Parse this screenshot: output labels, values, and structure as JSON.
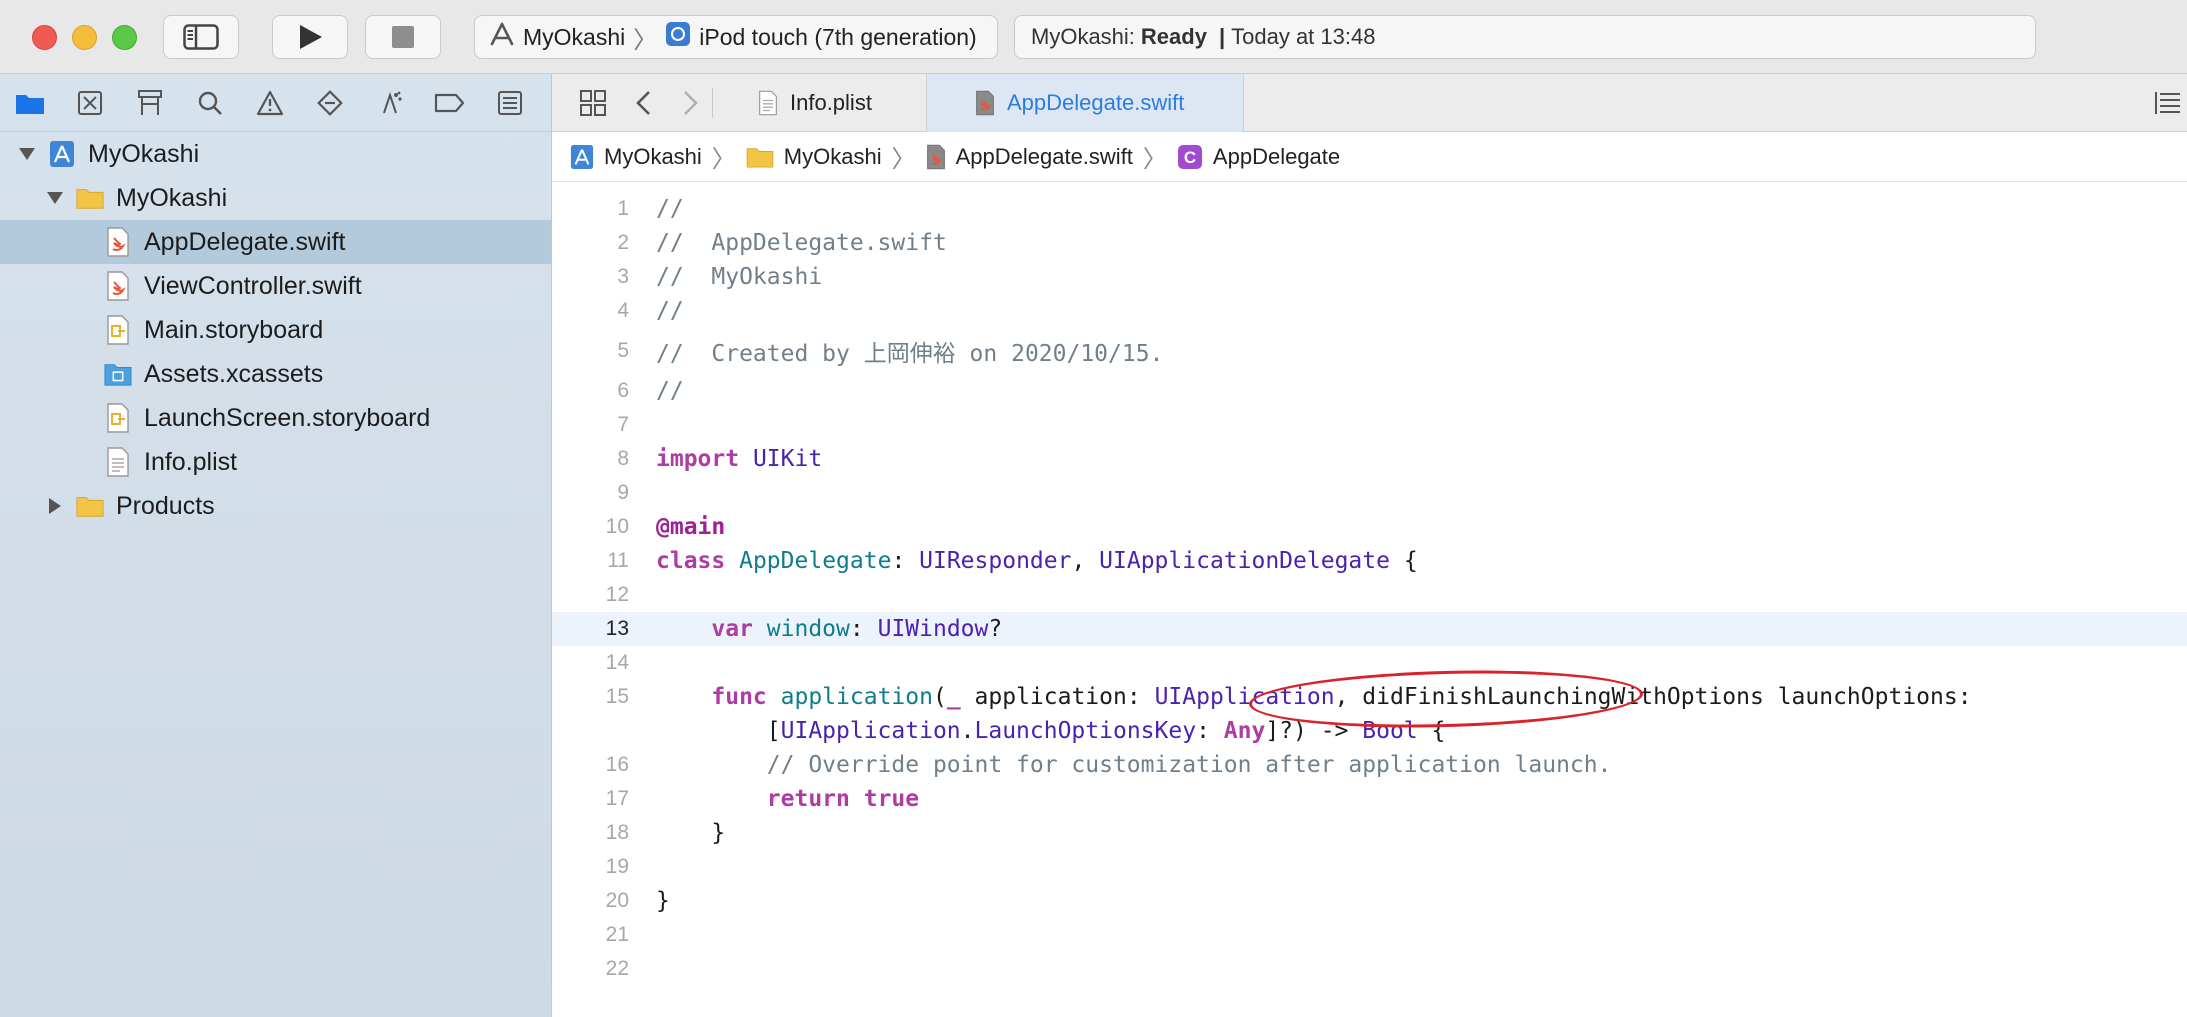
{
  "titlebar": {
    "scheme": {
      "project": "MyOkashi",
      "device": "iPod touch (7th generation)"
    },
    "activity": {
      "project": "MyOkashi:",
      "status": "Ready",
      "separator": "|",
      "time": "Today at 13:48"
    }
  },
  "navigator": {
    "toolbar_icons": [
      "folder-icon",
      "source-control-icon",
      "hierarchy-icon",
      "search-icon",
      "warning-icon",
      "test-icon",
      "debug-icon",
      "breakpoint-icon",
      "report-icon"
    ],
    "items": [
      {
        "label": "MyOkashi",
        "kind": "project",
        "depth": 0,
        "expanded": true
      },
      {
        "label": "MyOkashi",
        "kind": "folder",
        "depth": 1,
        "expanded": true
      },
      {
        "label": "AppDelegate.swift",
        "kind": "swift",
        "depth": 2,
        "selected": true
      },
      {
        "label": "ViewController.swift",
        "kind": "swift",
        "depth": 2
      },
      {
        "label": "Main.storyboard",
        "kind": "storyboard",
        "depth": 2
      },
      {
        "label": "Assets.xcassets",
        "kind": "assets",
        "depth": 2
      },
      {
        "label": "LaunchScreen.storyboard",
        "kind": "storyboard",
        "depth": 2
      },
      {
        "label": "Info.plist",
        "kind": "plist",
        "depth": 2
      },
      {
        "label": "Products",
        "kind": "folder",
        "depth": 1,
        "expanded": false
      }
    ]
  },
  "editor": {
    "tabs": [
      {
        "label": "Info.plist",
        "active": false
      },
      {
        "label": "AppDelegate.swift",
        "active": true
      }
    ],
    "jumpbar": [
      "MyOkashi",
      "MyOkashi",
      "AppDelegate.swift",
      "AppDelegate"
    ],
    "highlighted_line": 13,
    "lines": [
      {
        "n": "1",
        "text": "//"
      },
      {
        "n": "2",
        "text": "//  AppDelegate.swift"
      },
      {
        "n": "3",
        "text": "//  MyOkashi"
      },
      {
        "n": "4",
        "text": "//"
      },
      {
        "n": "5",
        "text": "//  Created by 上岡伸裕 on 2020/10/15."
      },
      {
        "n": "6",
        "text": "//"
      },
      {
        "n": "7",
        "text": ""
      },
      {
        "n": "8",
        "text": "import UIKit"
      },
      {
        "n": "9",
        "text": ""
      },
      {
        "n": "10",
        "text": "@main"
      },
      {
        "n": "11",
        "text": "class AppDelegate: UIResponder, UIApplicationDelegate {"
      },
      {
        "n": "12",
        "text": ""
      },
      {
        "n": "13",
        "text": "    var window: UIWindow?"
      },
      {
        "n": "14",
        "text": ""
      },
      {
        "n": "15",
        "text": "    func application(_ application: UIApplication, didFinishLaunchingWithOptions launchOptions:"
      },
      {
        "n": "",
        "text": "        [UIApplication.LaunchOptionsKey: Any]?) -> Bool {"
      },
      {
        "n": "16",
        "text": "        // Override point for customization after application launch."
      },
      {
        "n": "17",
        "text": "        return true"
      },
      {
        "n": "18",
        "text": "    }"
      },
      {
        "n": "19",
        "text": ""
      },
      {
        "n": "20",
        "text": "}"
      },
      {
        "n": "21",
        "text": ""
      },
      {
        "n": "22",
        "text": ""
      }
    ]
  },
  "colors": {
    "keyword": "#ad3da4",
    "comment": "#707f8c",
    "type": "#4b21b0",
    "identifier": "#0f7c8b",
    "annotation": "#d8232a",
    "accent": "#2a7ce0"
  }
}
